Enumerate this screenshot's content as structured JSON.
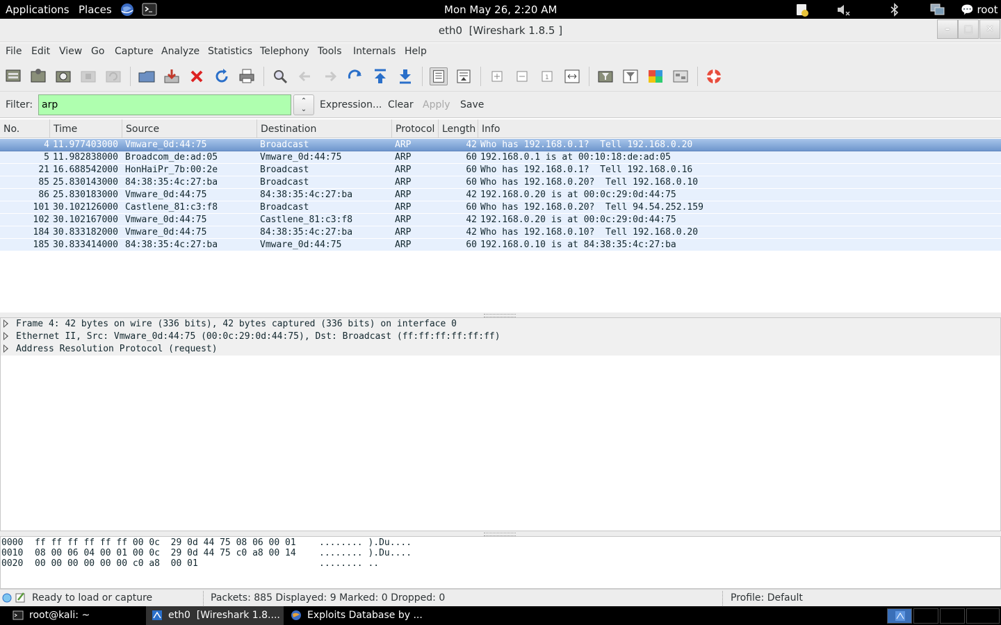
{
  "top_panel": {
    "applications": "Applications",
    "places": "Places",
    "clock": "Mon May 26,  2:20 AM",
    "user": "root"
  },
  "window": {
    "title": "eth0  [Wireshark 1.8.5 ]"
  },
  "menu": [
    "File",
    "Edit",
    "View",
    "Go",
    "Capture",
    "Analyze",
    "Statistics",
    "Telephony",
    "Tools",
    "Internals",
    "Help"
  ],
  "filter": {
    "label": "Filter:",
    "value": "arp",
    "expression": "Expression...",
    "clear": "Clear",
    "apply": "Apply",
    "save": "Save",
    "bg_color": "#afffaf"
  },
  "columns": [
    "No.",
    "Time",
    "Source",
    "Destination",
    "Protocol",
    "Length",
    "Info"
  ],
  "packets": [
    {
      "no": "4",
      "time": "11.977403000",
      "src": "Vmware_0d:44:75",
      "dst": "Broadcast",
      "proto": "ARP",
      "len": "42",
      "info": "Who has 192.168.0.1?  Tell 192.168.0.20",
      "selected": true
    },
    {
      "no": "5",
      "time": "11.982838000",
      "src": "Broadcom_de:ad:05",
      "dst": "Vmware_0d:44:75",
      "proto": "ARP",
      "len": "60",
      "info": "192.168.0.1 is at 00:10:18:de:ad:05"
    },
    {
      "no": "21",
      "time": "16.688542000",
      "src": "HonHaiPr_7b:00:2e",
      "dst": "Broadcast",
      "proto": "ARP",
      "len": "60",
      "info": "Who has 192.168.0.1?  Tell 192.168.0.16"
    },
    {
      "no": "85",
      "time": "25.830143000",
      "src": "84:38:35:4c:27:ba",
      "dst": "Broadcast",
      "proto": "ARP",
      "len": "60",
      "info": "Who has 192.168.0.20?  Tell 192.168.0.10"
    },
    {
      "no": "86",
      "time": "25.830183000",
      "src": "Vmware_0d:44:75",
      "dst": "84:38:35:4c:27:ba",
      "proto": "ARP",
      "len": "42",
      "info": "192.168.0.20 is at 00:0c:29:0d:44:75"
    },
    {
      "no": "101",
      "time": "30.102126000",
      "src": "Castlene_81:c3:f8",
      "dst": "Broadcast",
      "proto": "ARP",
      "len": "60",
      "info": "Who has 192.168.0.20?  Tell 94.54.252.159"
    },
    {
      "no": "102",
      "time": "30.102167000",
      "src": "Vmware_0d:44:75",
      "dst": "Castlene_81:c3:f8",
      "proto": "ARP",
      "len": "42",
      "info": "192.168.0.20 is at 00:0c:29:0d:44:75"
    },
    {
      "no": "184",
      "time": "30.833182000",
      "src": "Vmware_0d:44:75",
      "dst": "84:38:35:4c:27:ba",
      "proto": "ARP",
      "len": "42",
      "info": "Who has 192.168.0.10?  Tell 192.168.0.20"
    },
    {
      "no": "185",
      "time": "30.833414000",
      "src": "84:38:35:4c:27:ba",
      "dst": "Vmware_0d:44:75",
      "proto": "ARP",
      "len": "60",
      "info": "192.168.0.10 is at 84:38:35:4c:27:ba"
    }
  ],
  "details": [
    "Frame 4: 42 bytes on wire (336 bits), 42 bytes captured (336 bits) on interface 0",
    "Ethernet II, Src: Vmware_0d:44:75 (00:0c:29:0d:44:75), Dst: Broadcast (ff:ff:ff:ff:ff:ff)",
    "Address Resolution Protocol (request)"
  ],
  "bytes": [
    {
      "offset": "0000",
      "hex": "ff ff ff ff ff ff 00 0c  29 0d 44 75 08 06 00 01",
      "ascii": "........ ).Du...."
    },
    {
      "offset": "0010",
      "hex": "08 00 06 04 00 01 00 0c  29 0d 44 75 c0 a8 00 14",
      "ascii": "........ ).Du...."
    },
    {
      "offset": "0020",
      "hex": "00 00 00 00 00 00 c0 a8  00 01",
      "ascii": "........ .."
    }
  ],
  "status": {
    "ready": "Ready to load or capture",
    "packets": "Packets: 885 Displayed: 9 Marked: 0 Dropped: 0",
    "profile": "Profile: Default"
  },
  "taskbar": {
    "terminal": "root@kali: ~",
    "wireshark": "eth0  [Wireshark 1.8....",
    "browser": "Exploits Database by ..."
  },
  "colors": {
    "row_bg": "#e7f0fd",
    "selected_bg": "#6f97cd",
    "panel_bg": "#000000",
    "chrome_bg": "#ededed"
  }
}
